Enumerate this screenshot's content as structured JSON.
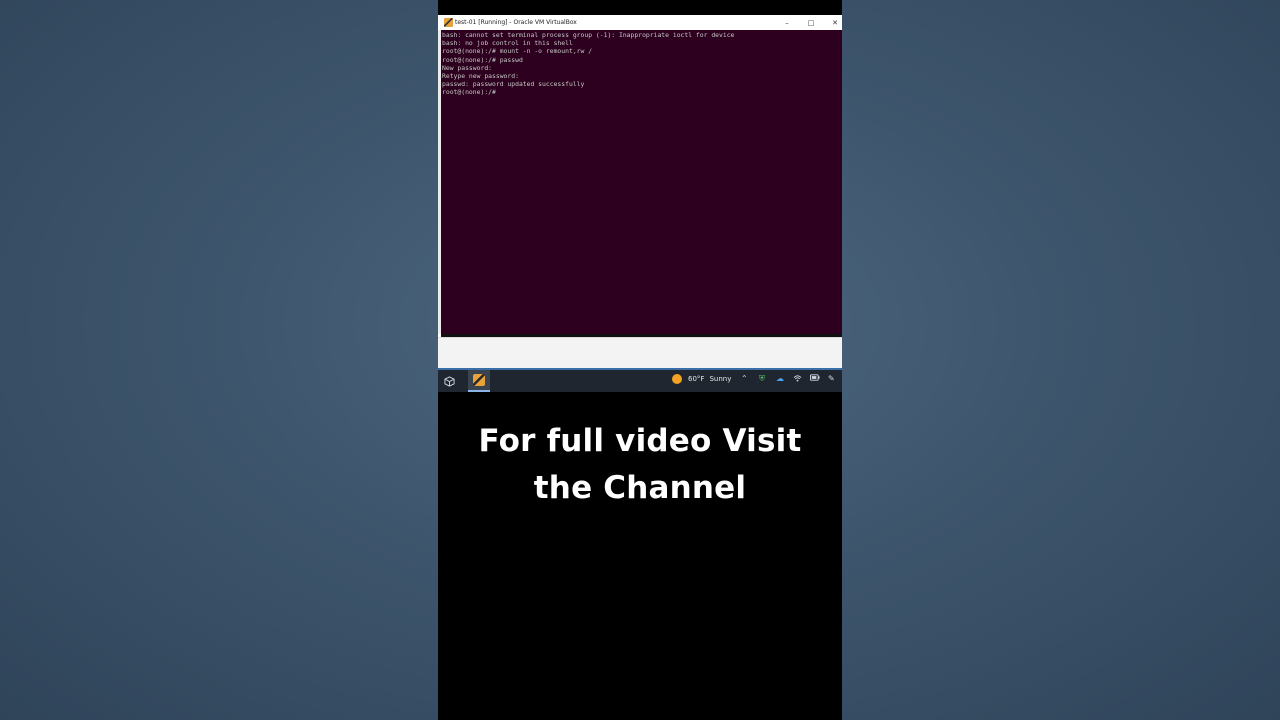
{
  "window": {
    "title": "test-01 [Running] - Oracle VM VirtualBox",
    "minimize_glyph": "–",
    "maximize_glyph": "□",
    "close_glyph": "✕"
  },
  "terminal": {
    "lines": [
      "bash: cannot set terminal process group (-1): Inappropriate ioctl for device",
      "bash: no job control in this shell",
      "root@(none):/# mount -n -o remount,rw /",
      "root@(none):/# passwd",
      "New password:",
      "Retype new password:",
      "passwd: password updated successfully",
      "root@(none):/#"
    ],
    "background": "#2c001e"
  },
  "taskbar": {
    "weather_temp": "60°F",
    "weather_condition": "Sunny",
    "icons": [
      "virtualbox-icon",
      "vm-window-icon",
      "sun-icon",
      "chevron-up-icon",
      "defender-shield-icon",
      "onedrive-cloud-icon",
      "wifi-icon",
      "battery-icon",
      "pen-icon"
    ]
  },
  "caption": {
    "line1": "For full video Visit",
    "line2": "the Channel"
  }
}
